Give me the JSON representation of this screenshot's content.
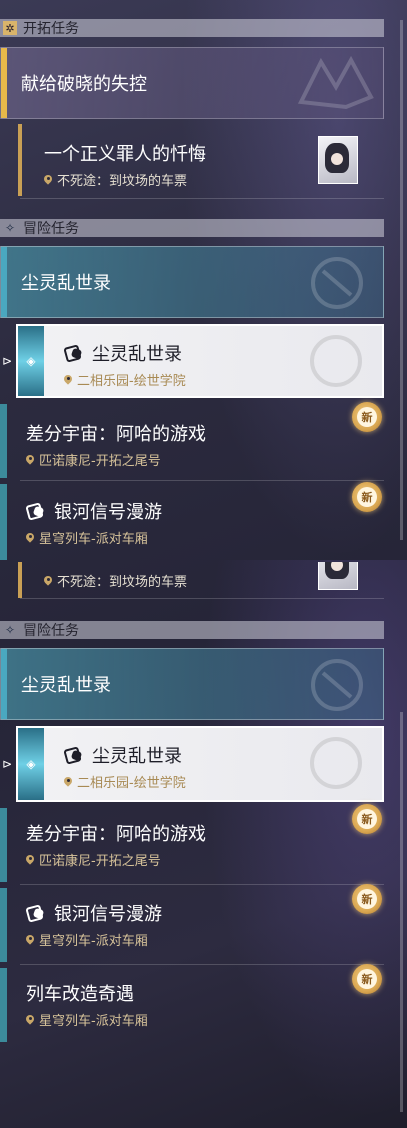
{
  "sections": {
    "trailblaze": {
      "title": "开拓任务"
    },
    "adventure": {
      "title": "冒险任务"
    }
  },
  "quests": {
    "trailblaze_main": {
      "title": "献给破晓的失控"
    },
    "trailblaze_sub": {
      "title": "一个正义罪人的忏悔",
      "location": "不死途：到坟场的车票"
    },
    "adventure_category": {
      "title": "尘灵乱世录"
    },
    "dust_chaos": {
      "title": "尘灵乱世录",
      "location": "二相乐园-绘世学院"
    },
    "differential": {
      "title": "差分宇宙：阿哈的游戏",
      "location": "匹诺康尼-开拓之尾号"
    },
    "galaxy_signal": {
      "title": "银河信号漫游",
      "location": "星穹列车-派对车厢"
    },
    "train_mod": {
      "title": "列车改造奇遇",
      "location": "星穹列车-派对车厢"
    }
  },
  "badges": {
    "new": "新"
  },
  "colors": {
    "accent_gold": "#e8b94a",
    "accent_teal": "#4aa8c0",
    "selected_bg": "#efeff2"
  }
}
